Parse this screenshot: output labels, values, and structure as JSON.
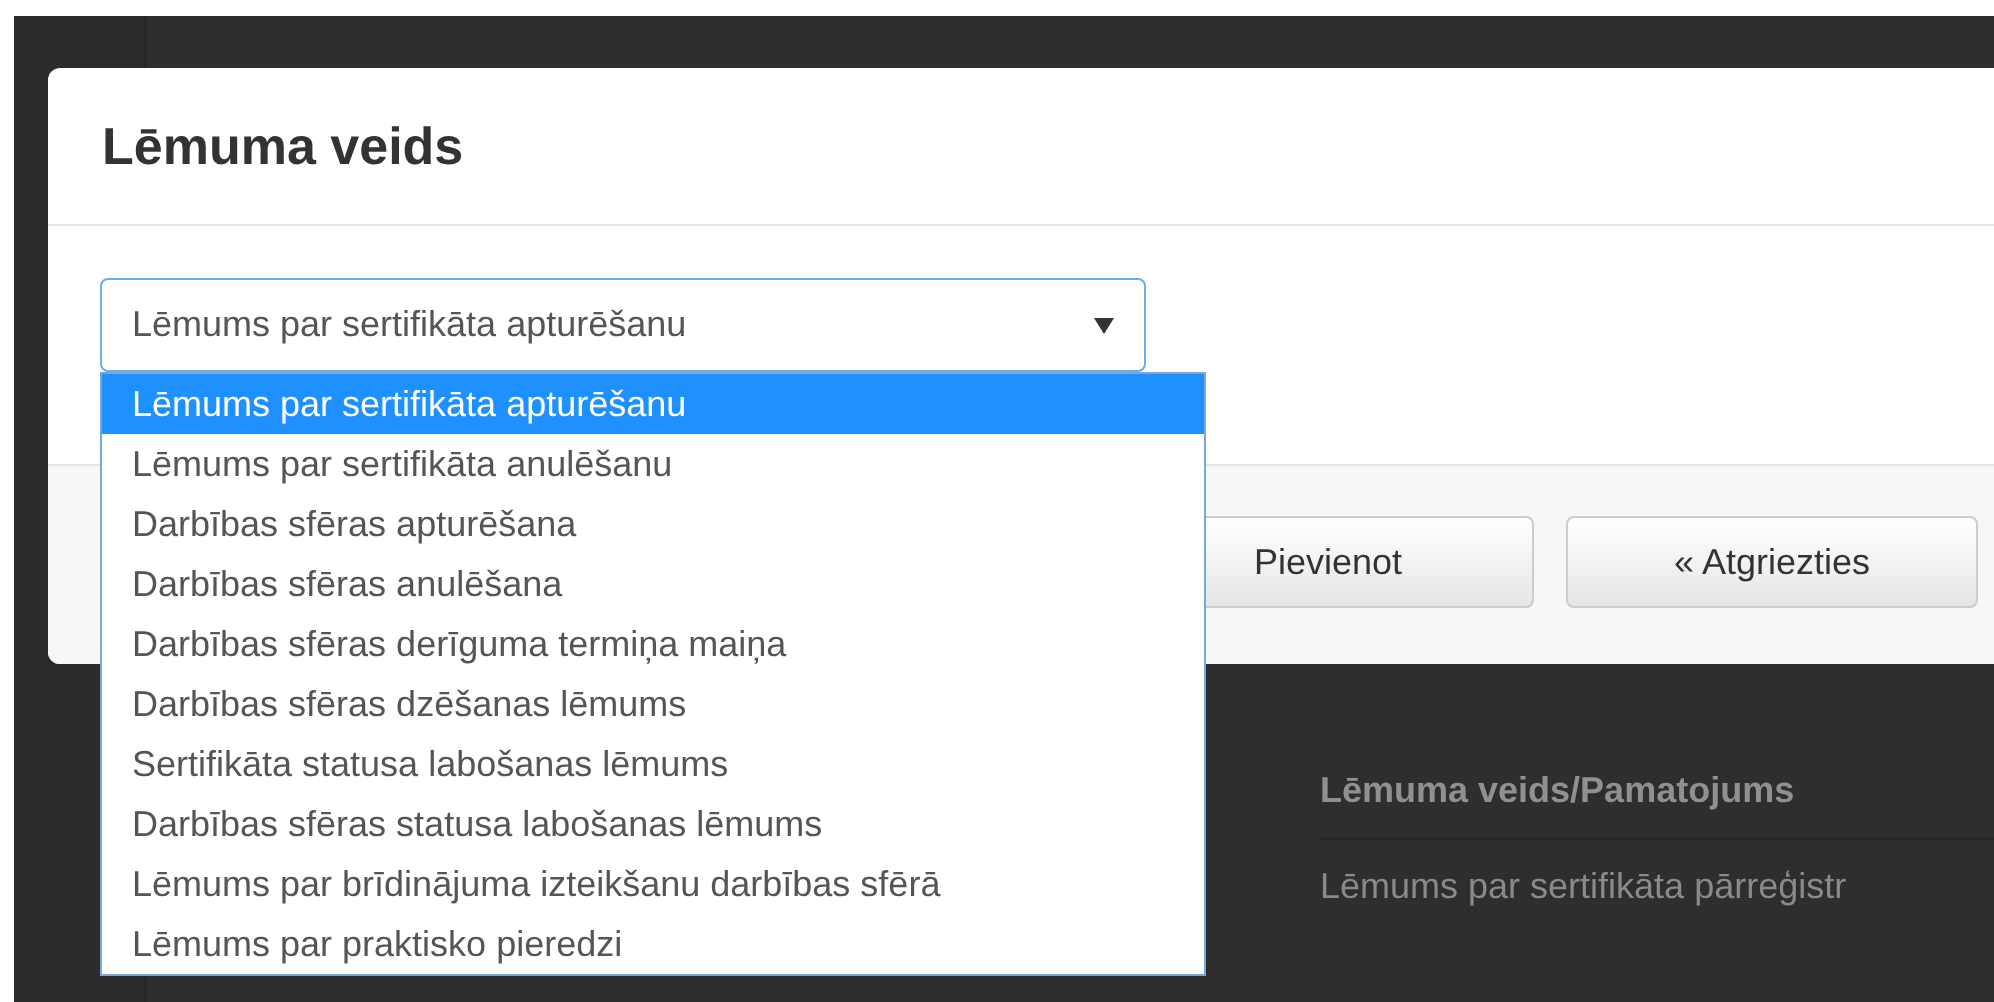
{
  "background": {
    "table": {
      "columns": [
        "Lēmuma veids/Pamatojums"
      ],
      "rows": [
        "Lēmums par sertifikāta pārreģistr"
      ]
    }
  },
  "modal": {
    "title": "Lēmuma veids",
    "select": {
      "value": "Lēmums par sertifikāta apturēšanu",
      "expanded": true,
      "options": [
        {
          "label": "Lēmums par sertifikāta apturēšanu",
          "selected": true
        },
        {
          "label": "Lēmums par sertifikāta anulēšanu",
          "selected": false
        },
        {
          "label": "Darbības sfēras apturēšana",
          "selected": false
        },
        {
          "label": "Darbības sfēras anulēšana",
          "selected": false
        },
        {
          "label": "Darbības sfēras derīguma termiņa maiņa",
          "selected": false
        },
        {
          "label": "Darbības sfēras dzēšanas lēmums",
          "selected": false
        },
        {
          "label": "Sertifikāta statusa labošanas lēmums",
          "selected": false
        },
        {
          "label": "Darbības sfēras statusa labošanas lēmums",
          "selected": false
        },
        {
          "label": "Lēmums par brīdinājuma izteikšanu darbības sfērā",
          "selected": false
        },
        {
          "label": "Lēmums par praktisko pieredzi",
          "selected": false
        }
      ]
    },
    "buttons": [
      "Pievienot",
      "« Atgriezties"
    ]
  }
}
